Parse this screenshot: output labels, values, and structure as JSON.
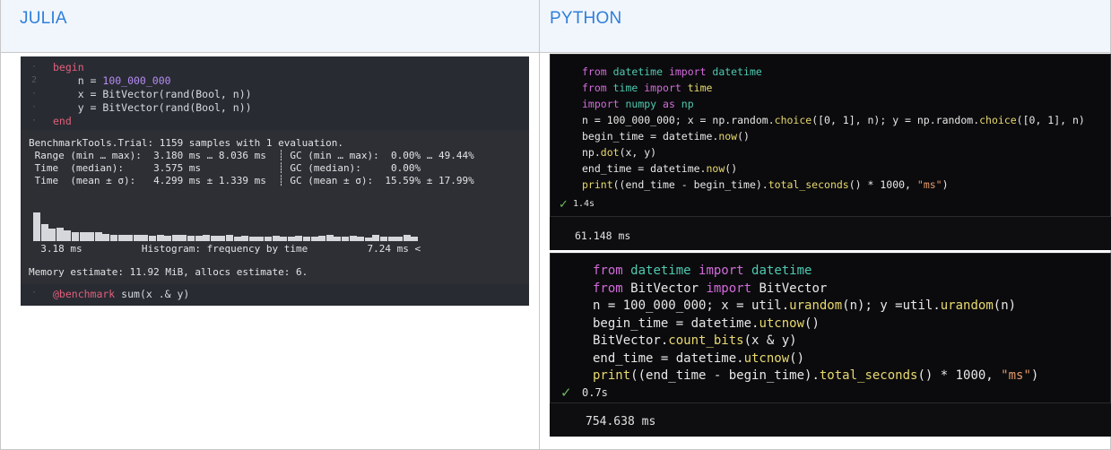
{
  "headers": {
    "left": "JULIA",
    "right": "PYTHON"
  },
  "julia": {
    "code": [
      {
        "gutter": "·",
        "parts": [
          {
            "t": "begin",
            "c": "kw"
          }
        ]
      },
      {
        "gutter": "2",
        "parts": [
          {
            "t": "    n = ",
            "c": ""
          },
          {
            "t": "100_000_000",
            "c": "num"
          }
        ]
      },
      {
        "gutter": "·",
        "parts": [
          {
            "t": "    x = BitVector(rand(Bool, n))",
            "c": ""
          }
        ]
      },
      {
        "gutter": "·",
        "parts": [
          {
            "t": "    y = BitVector(rand(Bool, n))",
            "c": ""
          }
        ]
      },
      {
        "gutter": "·",
        "parts": [
          {
            "t": "end",
            "c": "kw"
          }
        ]
      }
    ],
    "output": [
      "BenchmarkTools.Trial: 1159 samples with 1 evaluation.",
      " Range (min … max):  3.180 ms … 8.036 ms  ┊ GC (min … max):  0.00% … 49.44%",
      " Time  (median):     3.575 ms             ┊ GC (median):     0.00%",
      " Time  (mean ± σ):   4.299 ms ± 1.339 ms  ┊ GC (mean ± σ):  15.59% ± 17.99%"
    ],
    "histogram_heights": [
      0.95,
      0.55,
      0.4,
      0.45,
      0.35,
      0.3,
      0.3,
      0.28,
      0.3,
      0.25,
      0.22,
      0.22,
      0.2,
      0.2,
      0.22,
      0.18,
      0.2,
      0.18,
      0.2,
      0.2,
      0.18,
      0.18,
      0.2,
      0.18,
      0.18,
      0.2,
      0.15,
      0.18,
      0.15,
      0.15,
      0.15,
      0.18,
      0.15,
      0.15,
      0.18,
      0.15,
      0.15,
      0.18,
      0.22,
      0.15,
      0.15,
      0.18,
      0.15,
      0.12,
      0.2,
      0.15,
      0.15,
      0.15,
      0.2,
      0.15
    ],
    "hist_axis": "  3.18 ms          Histogram: frequency by time          7.24 ms <",
    "memory": "Memory estimate: 11.92 MiB, allocs estimate: 6.",
    "benchmark_gutter": "·",
    "benchmark_macro": "@benchmark",
    "benchmark_expr": " sum(x .& y)"
  },
  "python1": {
    "code": [
      [
        {
          "t": "from ",
          "c": "kwp"
        },
        {
          "t": "datetime ",
          "c": "grn"
        },
        {
          "t": "import ",
          "c": "kwp"
        },
        {
          "t": "datetime",
          "c": "grn"
        }
      ],
      [
        {
          "t": "from ",
          "c": "kwp"
        },
        {
          "t": "time ",
          "c": "grn"
        },
        {
          "t": "import ",
          "c": "kwp"
        },
        {
          "t": "time",
          "c": "fnp"
        }
      ],
      [
        {
          "t": "import ",
          "c": "kwp"
        },
        {
          "t": "numpy ",
          "c": "grn"
        },
        {
          "t": "as ",
          "c": "kwp"
        },
        {
          "t": "np",
          "c": "grn"
        }
      ],
      [
        {
          "t": "n = 100_000_000; x = np.random.",
          "c": ""
        },
        {
          "t": "choice",
          "c": "fnp"
        },
        {
          "t": "([0, 1], n); y = np.random.",
          "c": ""
        },
        {
          "t": "choice",
          "c": "fnp"
        },
        {
          "t": "([0, 1], n)",
          "c": ""
        }
      ],
      [
        {
          "t": "begin_time = datetime.",
          "c": ""
        },
        {
          "t": "now",
          "c": "fnp"
        },
        {
          "t": "()",
          "c": ""
        }
      ],
      [
        {
          "t": "np.",
          "c": ""
        },
        {
          "t": "dot",
          "c": "fnp"
        },
        {
          "t": "(x, y)",
          "c": ""
        }
      ],
      [
        {
          "t": "end_time = datetime.",
          "c": ""
        },
        {
          "t": "now",
          "c": "fnp"
        },
        {
          "t": "()",
          "c": ""
        }
      ],
      [
        {
          "t": "print",
          "c": "fnp"
        },
        {
          "t": "((end_time - begin_time).",
          "c": ""
        },
        {
          "t": "total_seconds",
          "c": "fnp"
        },
        {
          "t": "() * 1000, ",
          "c": ""
        },
        {
          "t": "\"ms\"",
          "c": "strp"
        },
        {
          "t": ")",
          "c": ""
        }
      ]
    ],
    "check": "✓",
    "time": "1.4s",
    "result": "61.148 ms"
  },
  "python2": {
    "code": [
      [
        {
          "t": "from ",
          "c": "kwp"
        },
        {
          "t": "datetime ",
          "c": "grn"
        },
        {
          "t": "import ",
          "c": "kwp"
        },
        {
          "t": "datetime",
          "c": "grn"
        }
      ],
      [
        {
          "t": "from ",
          "c": "kwp"
        },
        {
          "t": "BitVector ",
          "c": ""
        },
        {
          "t": "import ",
          "c": "kwp"
        },
        {
          "t": "BitVector",
          "c": ""
        }
      ],
      [
        {
          "t": "n = 100_000_000; x = util.",
          "c": ""
        },
        {
          "t": "urandom",
          "c": "fnp"
        },
        {
          "t": "(n); y =util.",
          "c": ""
        },
        {
          "t": "urandom",
          "c": "fnp"
        },
        {
          "t": "(n)",
          "c": ""
        }
      ],
      [
        {
          "t": "begin_time = datetime.",
          "c": ""
        },
        {
          "t": "utcnow",
          "c": "fnp"
        },
        {
          "t": "()",
          "c": ""
        }
      ],
      [
        {
          "t": "BitVector.",
          "c": ""
        },
        {
          "t": "count_bits",
          "c": "fnp"
        },
        {
          "t": "(x & y)",
          "c": ""
        }
      ],
      [
        {
          "t": "end_time = datetime.",
          "c": ""
        },
        {
          "t": "utcnow",
          "c": "fnp"
        },
        {
          "t": "()",
          "c": ""
        }
      ],
      [
        {
          "t": "print",
          "c": "fnp"
        },
        {
          "t": "((end_time - begin_time).",
          "c": ""
        },
        {
          "t": "total_seconds",
          "c": "fnp"
        },
        {
          "t": "() * 1000, ",
          "c": ""
        },
        {
          "t": "\"ms\"",
          "c": "strp"
        },
        {
          "t": ")",
          "c": ""
        }
      ]
    ],
    "check": "✓",
    "time": "0.7s",
    "result": "754.638 ms"
  }
}
